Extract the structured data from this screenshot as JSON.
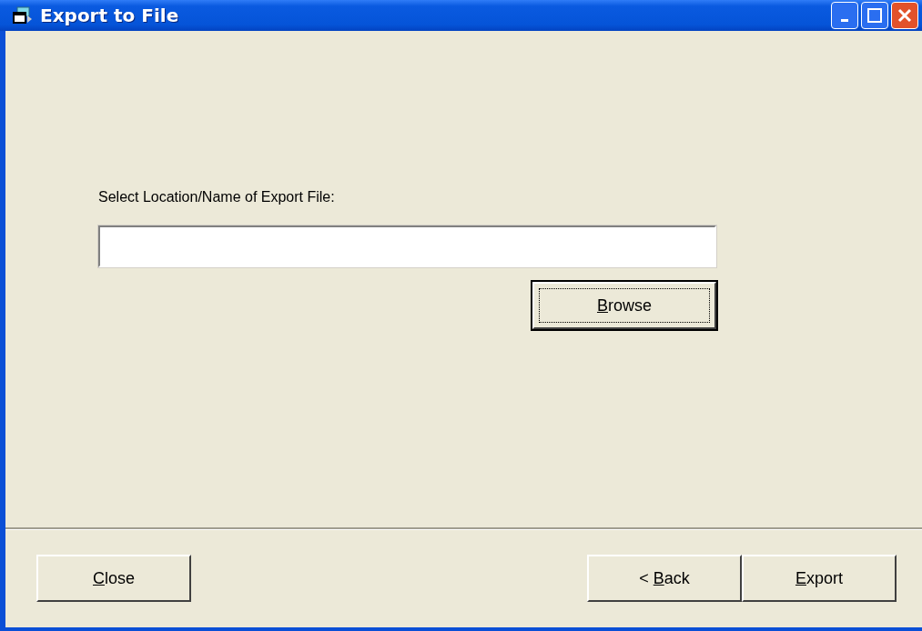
{
  "window": {
    "title": "Export to File"
  },
  "form": {
    "label": "Select Location/Name of Export File:",
    "browse_button": {
      "key": "B",
      "after": "rowse",
      "focused": true
    }
  },
  "footer_buttons": [
    {
      "key": "C",
      "after": "lose",
      "focused": false
    },
    {
      "before": "< ",
      "key": "B",
      "after": "ack",
      "focused": false
    },
    {
      "key": "E",
      "after": "xport",
      "focused": false
    }
  ]
}
